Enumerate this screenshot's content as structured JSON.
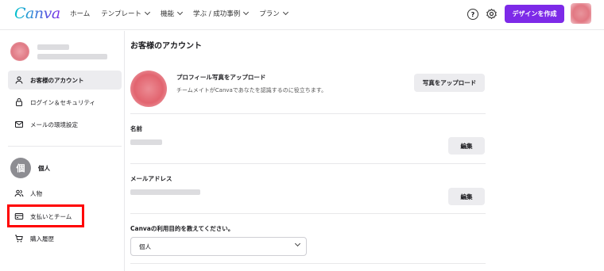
{
  "brand": {
    "logo": "Canva",
    "accent": "#7d2ae8"
  },
  "nav": {
    "items": [
      {
        "label": "ホーム",
        "has_menu": false
      },
      {
        "label": "テンプレート",
        "has_menu": true
      },
      {
        "label": "機能",
        "has_menu": true
      },
      {
        "label": "学ぶ / 成功事例",
        "has_menu": true
      },
      {
        "label": "プラン",
        "has_menu": true
      }
    ],
    "help_icon": "?",
    "create_button": "デザインを作成"
  },
  "sidebar": {
    "items": [
      {
        "label": "お客様のアカウント",
        "icon": "account-icon",
        "active": true
      },
      {
        "label": "ログイン＆セキュリティ",
        "icon": "lock-icon",
        "active": false
      },
      {
        "label": "メールの環境設定",
        "icon": "mail-icon",
        "active": false
      }
    ],
    "team": {
      "avatar_letter": "個",
      "name": "個人"
    },
    "team_items": [
      {
        "label": "人物",
        "icon": "people-icon"
      },
      {
        "label": "支払いとチーム",
        "icon": "credit-card-icon",
        "highlighted": true
      },
      {
        "label": "購入履歴",
        "icon": "cart-icon"
      }
    ],
    "highlight_color": "#ff0000"
  },
  "main": {
    "title": "お客様のアカウント",
    "photo": {
      "heading": "プロフィール写真をアップロード",
      "description": "チームメイトがCanvaであなたを認識するのに役立ちます。",
      "button": "写真をアップロード"
    },
    "name": {
      "label": "名前",
      "button": "編集"
    },
    "email": {
      "label": "メールアドレス",
      "button": "編集"
    },
    "purpose": {
      "label": "Canvaの利用目的を教えてください。",
      "selected": "個人"
    }
  }
}
